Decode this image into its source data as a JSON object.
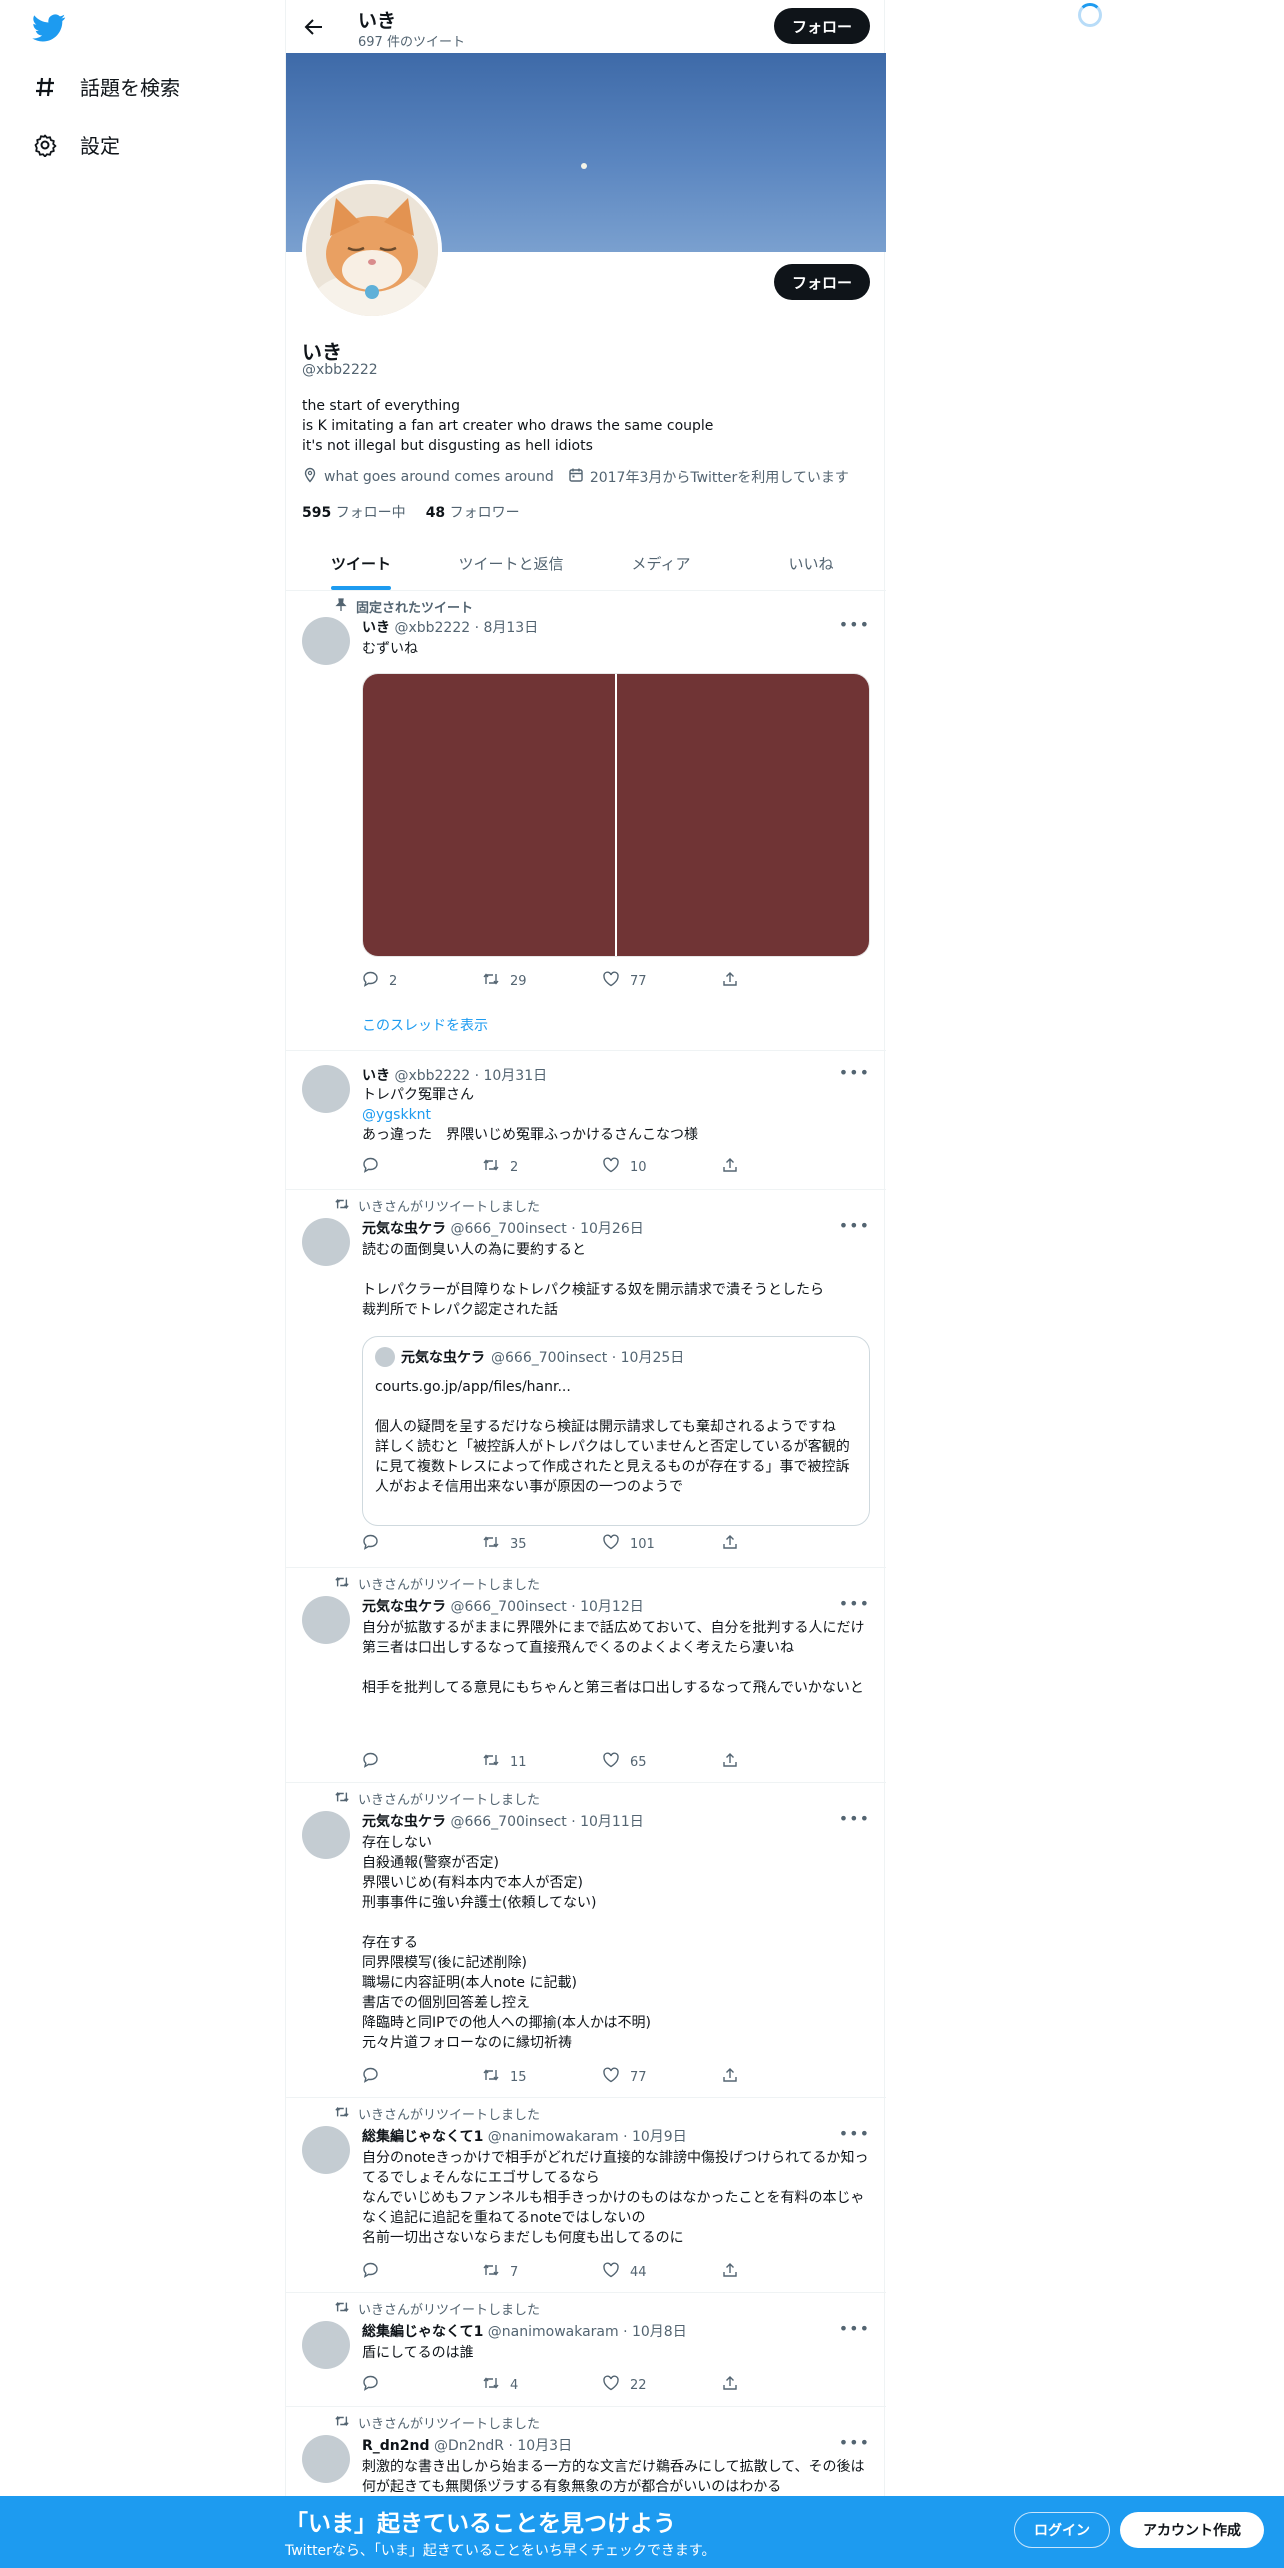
{
  "nav": {
    "explore_label": "話題を検索",
    "settings_label": "設定"
  },
  "header": {
    "title": "いき",
    "tweet_count": "697 件のツイート",
    "follow_label": "フォロー"
  },
  "profile": {
    "follow_label": "フォロー",
    "name": "いき",
    "handle": "@xbb2222",
    "bio": "the start of everything\nis K imitating a fan art creater who draws the same couple\nit's not illegal but disgusting as hell idiots",
    "location": "what goes around comes around",
    "joined": "2017年3月からTwitterを利用しています",
    "following_count": "595",
    "following_label": "フォロー中",
    "followers_count": "48",
    "followers_label": "フォロワー"
  },
  "tabs": [
    "ツイート",
    "ツイートと返信",
    "メディア",
    "いいね"
  ],
  "tweets": [
    {
      "context": "固定されたツイート",
      "name": "いき",
      "meta": "@xbb2222 · 8月13日",
      "body": "むずいね",
      "replies": "2",
      "retweets": "29",
      "likes": "77",
      "thread_link": "このスレッドを表示"
    },
    {
      "name": "いき",
      "meta": "@xbb2222 · 10月31日",
      "body_1": "トレパク冤罪さん",
      "mention": "@ygskknt",
      "body_2": "あっ違った　界隈いじめ冤罪ふっかけるさんこなつ様",
      "replies": "",
      "retweets": "2",
      "likes": "10"
    },
    {
      "context": "いきさんがリツイートしました",
      "name": "元気な虫ケラ",
      "meta": "@666_700insect · 10月26日",
      "body": "読むの面倒臭い人の為に要約すると\n\nトレパクラーが目障りなトレパク検証する奴を開示請求で潰そうとしたら\n裁判所でトレパク認定された話",
      "quote": {
        "name": "元気な虫ケラ",
        "meta": "@666_700insect · 10月25日",
        "body": "courts.go.jp/app/files/hanr...\n\n個人の疑問を呈するだけなら検証は開示請求しても棄却されるようですね\n詳しく読むと「被控訴人がトレパクはしていませんと否定しているが客観的に見て複数トレスによって作成されたと見えるものが存在する」事で被控訴人がおよそ信用出来ない事が原因の一つのようで"
      },
      "replies": "",
      "retweets": "35",
      "likes": "101"
    },
    {
      "context": "いきさんがリツイートしました",
      "name": "元気な虫ケラ",
      "meta": "@666_700insect · 10月12日",
      "body": "自分が拡散するがままに界隈外にまで話広めておいて、自分を批判する人にだけ第三者は口出しするなって直接飛んでくるのよくよく考えたら凄いね\n\n相手を批判してる意見にもちゃんと第三者は口出しするなって飛んでいかないと",
      "replies": "",
      "retweets": "11",
      "likes": "65"
    },
    {
      "context": "いきさんがリツイートしました",
      "name": "元気な虫ケラ",
      "meta": "@666_700insect · 10月11日",
      "body": "存在しない\n自殺通報(警察が否定)\n界隈いじめ(有料本内で本人が否定)\n刑事事件に強い弁護士(依頼してない)\n\n存在する\n同界隈模写(後に記述削除)\n職場に内容証明(本人note に記載)\n書店での個別回答差し控え\n降臨時と同IPでの他人への揶揄(本人かは不明)\n元々片道フォローなのに縁切祈祷",
      "replies": "",
      "retweets": "15",
      "likes": "77"
    },
    {
      "context": "いきさんがリツイートしました",
      "name": "総集編じゃなくて1",
      "meta": "@nanimowakaram · 10月9日",
      "body": "自分のnoteきっかけで相手がどれだけ直接的な誹謗中傷投げつけられてるか知ってるでしょそんなにエゴサしてるなら\nなんでいじめもファンネルも相手きっかけのものはなかったことを有料の本じゃなく追記に追記を重ねてるnoteではしないの\n名前一切出さないならまだしも何度も出してるのに",
      "replies": "",
      "retweets": "7",
      "likes": "44"
    },
    {
      "context": "いきさんがリツイートしました",
      "name": "総集編じゃなくて1",
      "meta": "@nanimowakaram · 10月8日",
      "body": "盾にしてるのは誰",
      "replies": "",
      "retweets": "4",
      "likes": "22"
    },
    {
      "context": "いきさんがリツイートしました",
      "name": "R_dn2nd",
      "meta": "@Dn2ndR · 10月3日",
      "body": "刺激的な書き出しから始まる一方的な文言だけ鵜呑みにして拡散して、その後は何が起きても無関係ヅラする有象無象の方が都合がいいのはわかる"
    }
  ],
  "bottom_bar": {
    "title": "「いま」起きていることを見つけよう",
    "subtitle": "Twitterなら、「いま」起きていることをいち早くチェックできます。",
    "login_label": "ログイン",
    "signup_label": "アカウント作成"
  },
  "colors": {
    "accent": "#1d9bf0",
    "text": "#0f1419",
    "secondary": "#536471",
    "media": "#703435"
  }
}
